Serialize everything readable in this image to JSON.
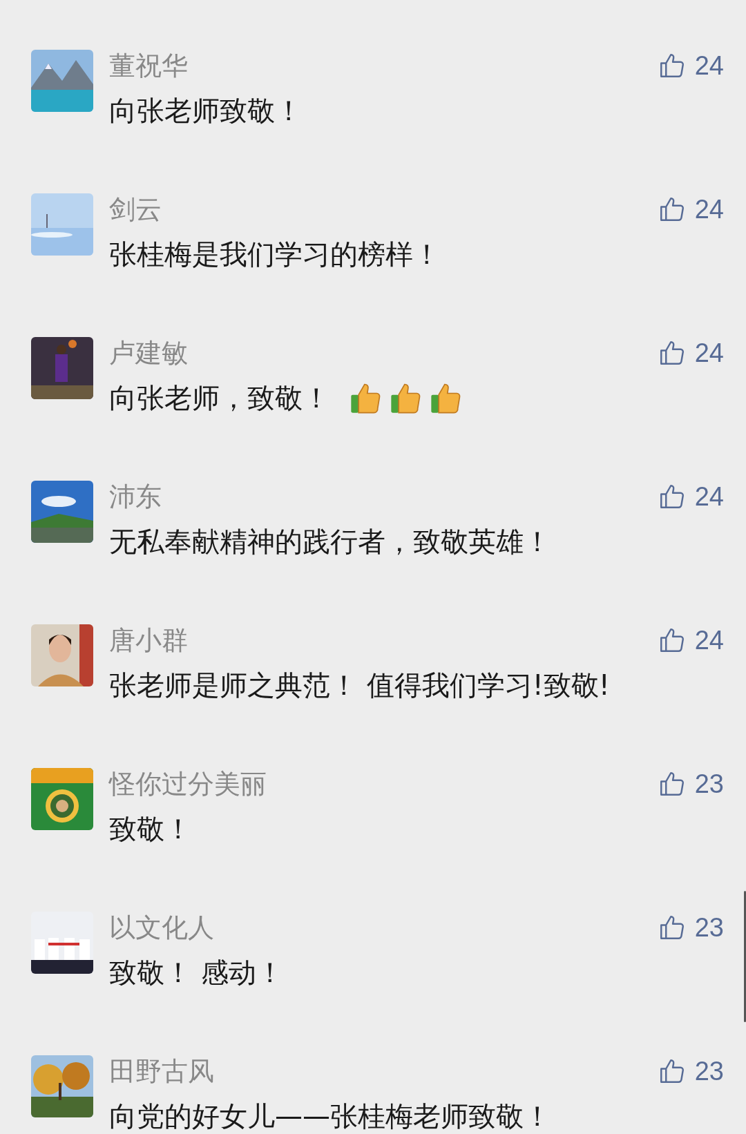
{
  "comments": [
    {
      "name": "董祝华",
      "likes": "24",
      "text": "向张老师致敬！"
    },
    {
      "name": "剑云",
      "likes": "24",
      "text": "张桂梅是我们学习的榜样！"
    },
    {
      "name": "卢建敏",
      "likes": "24",
      "text": "向张老师，致敬！",
      "emojis": [
        {
          "kind": "thumbs-up"
        },
        {
          "kind": "thumbs-up"
        },
        {
          "kind": "thumbs-up"
        }
      ]
    },
    {
      "name": "沛东",
      "likes": "24",
      "text": "无私奉献精神的践行者，致敬英雄！"
    },
    {
      "name": "唐小群",
      "likes": "24",
      "text": "张老师是师之典范！ 值得我们学习!致敬!"
    },
    {
      "name": "怪你过分美丽",
      "likes": "23",
      "text": "致敬！"
    },
    {
      "name": "以文化人",
      "likes": "23",
      "text": "致敬！ 感动！"
    },
    {
      "name": "田野古风",
      "likes": "23",
      "text": "向党的好女儿——张桂梅老师致敬！"
    }
  ]
}
